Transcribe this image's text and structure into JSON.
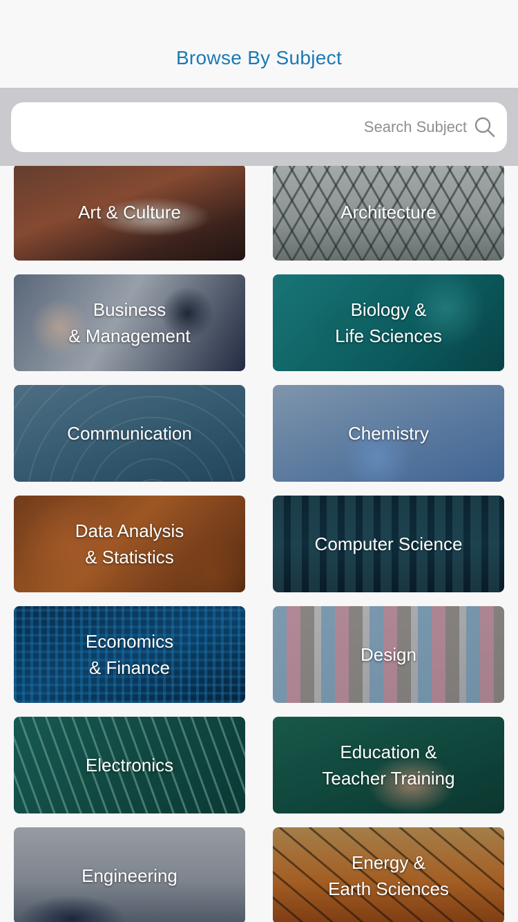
{
  "header": {
    "title": "Browse By Subject"
  },
  "search": {
    "placeholder": "Search Subject",
    "icon": "search-icon"
  },
  "subjects": [
    {
      "label": "Art & Culture",
      "name": "art-culture"
    },
    {
      "label": "Architecture",
      "name": "architecture"
    },
    {
      "label": "Business\n& Management",
      "name": "business-management"
    },
    {
      "label": "Biology &\nLife Sciences",
      "name": "biology-life-sciences"
    },
    {
      "label": "Communication",
      "name": "communication"
    },
    {
      "label": "Chemistry",
      "name": "chemistry"
    },
    {
      "label": "Data Analysis\n& Statistics",
      "name": "data-analysis-statistics"
    },
    {
      "label": "Computer Science",
      "name": "computer-science"
    },
    {
      "label": "Economics\n& Finance",
      "name": "economics-finance"
    },
    {
      "label": "Design",
      "name": "design"
    },
    {
      "label": "Electronics",
      "name": "electronics"
    },
    {
      "label": "Education &\nTeacher Training",
      "name": "education-teacher-training"
    },
    {
      "label": "Engineering",
      "name": "engineering"
    },
    {
      "label": "Energy &\nEarth Sciences",
      "name": "energy-earth-sciences"
    }
  ],
  "colors": {
    "title": "#1a7ab5",
    "search_bar_bg": "#c9c9ce",
    "search_box_bg": "#ffffff"
  }
}
